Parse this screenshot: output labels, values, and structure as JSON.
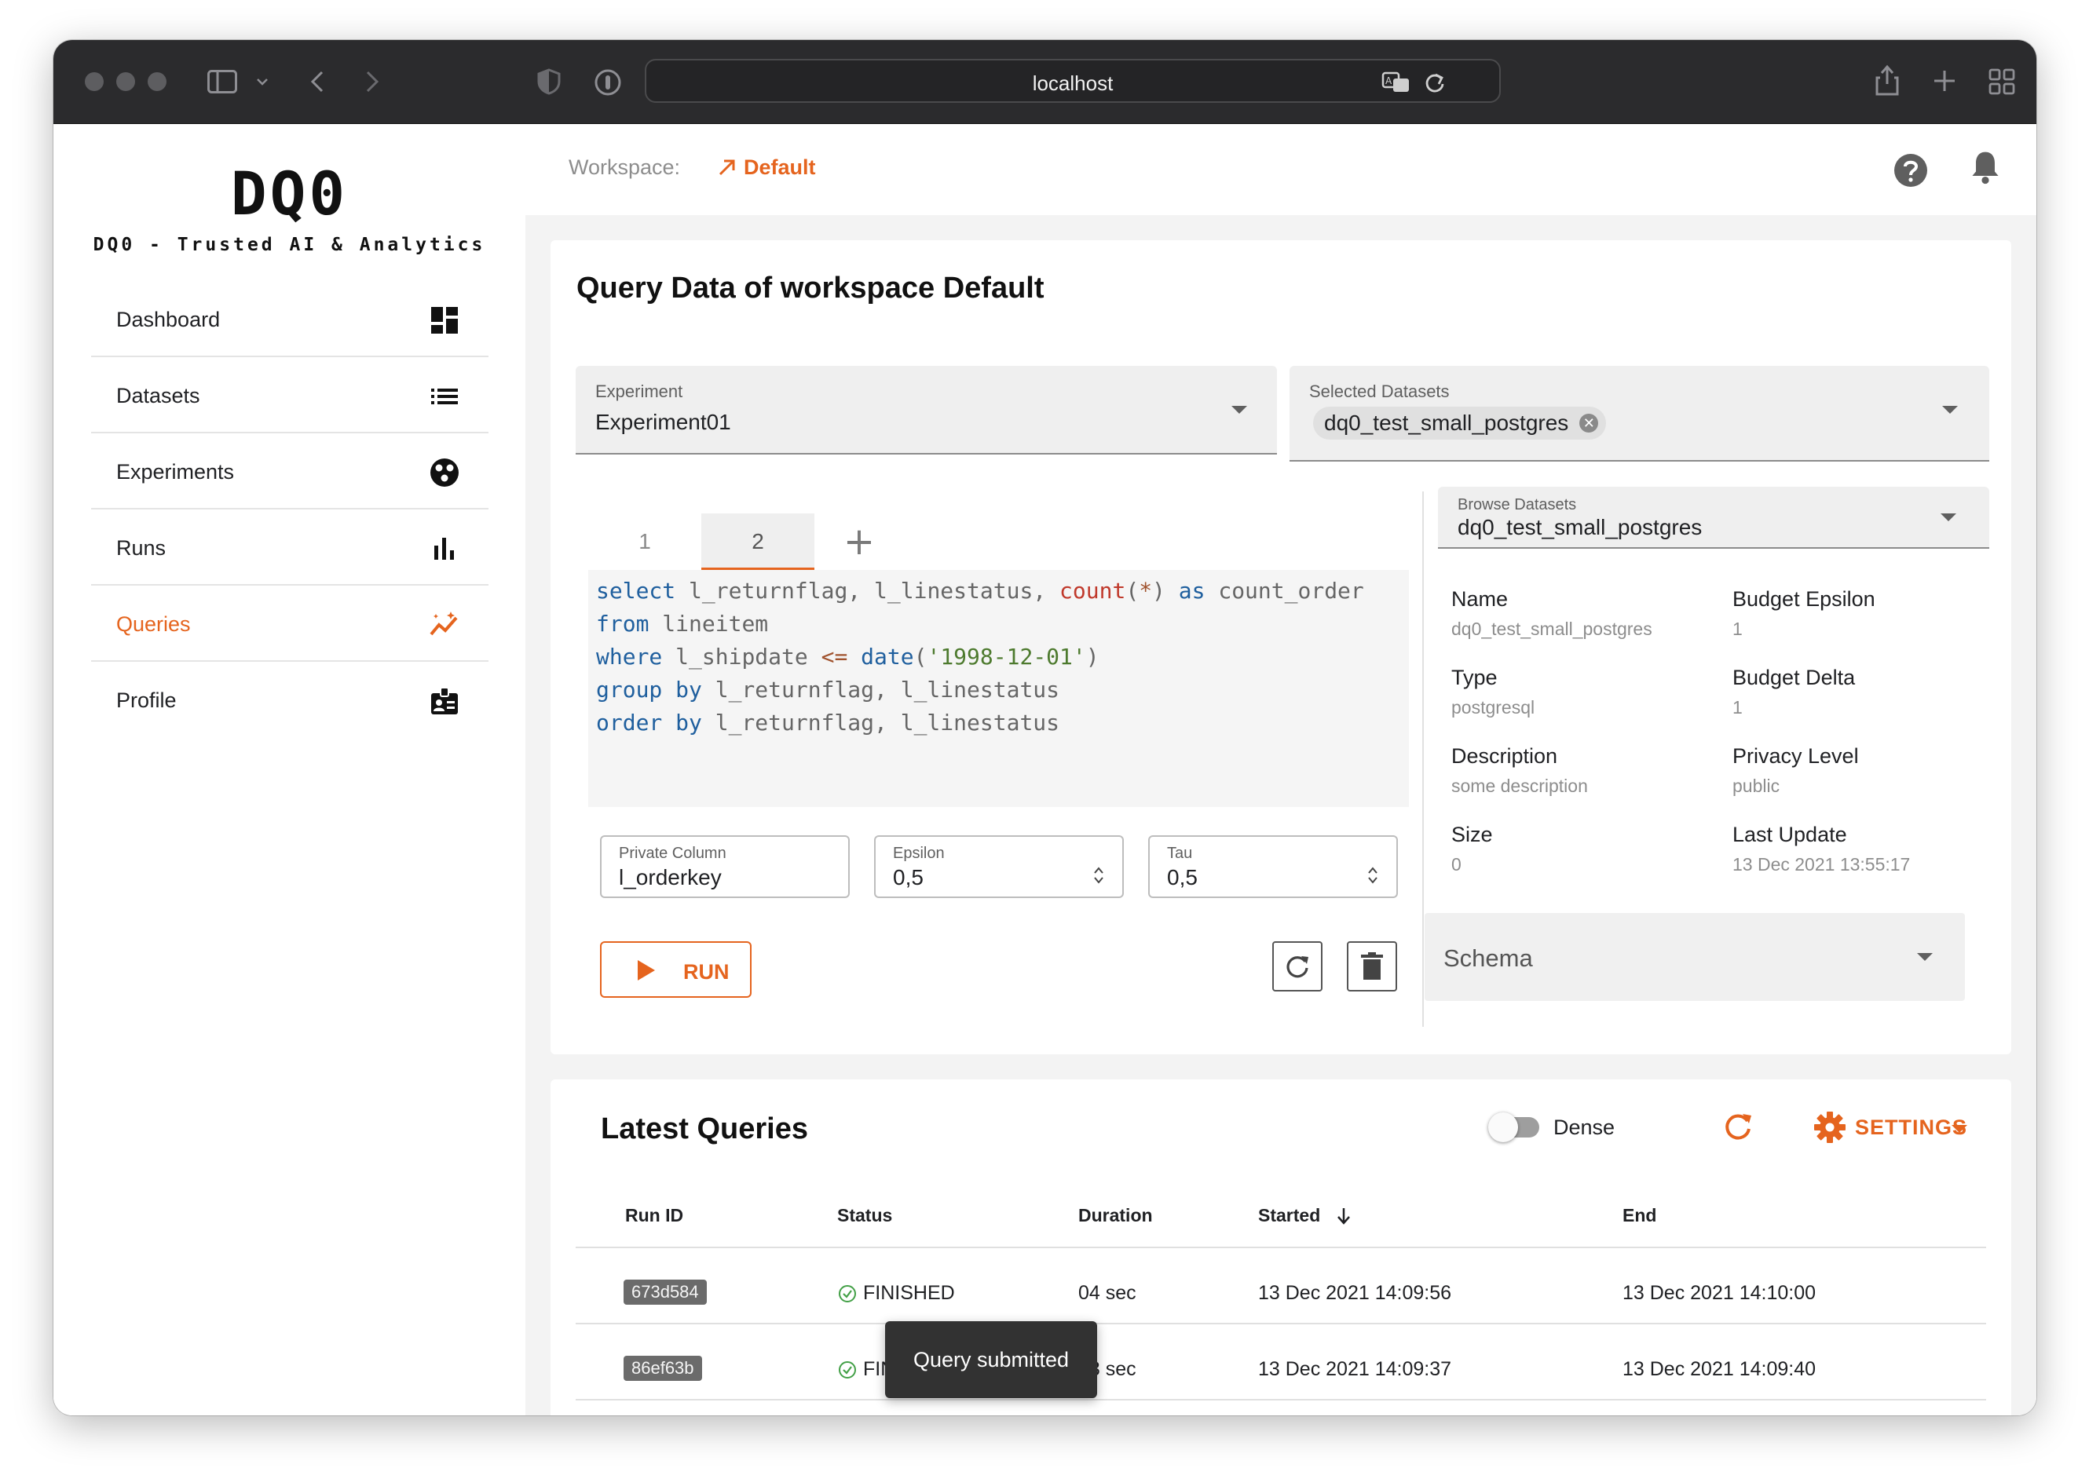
{
  "browser": {
    "url": "localhost"
  },
  "brand": {
    "logo": "DQ0",
    "tagline": "DQ0 - Trusted AI & Analytics",
    "accent_color": "#e5641e"
  },
  "sidebar": {
    "items": [
      {
        "label": "Dashboard",
        "icon": "dashboard-icon",
        "active": false
      },
      {
        "label": "Datasets",
        "icon": "list-icon",
        "active": false
      },
      {
        "label": "Experiments",
        "icon": "experiments-icon",
        "active": false
      },
      {
        "label": "Runs",
        "icon": "bar-chart-icon",
        "active": false
      },
      {
        "label": "Queries",
        "icon": "queries-icon",
        "active": true
      },
      {
        "label": "Profile",
        "icon": "profile-badge-icon",
        "active": false
      }
    ]
  },
  "topbar": {
    "workspace_label": "Workspace:",
    "workspace_value": "Default"
  },
  "query_card": {
    "title": "Query Data of workspace Default",
    "experiment": {
      "label": "Experiment",
      "value": "Experiment01"
    },
    "selected_datasets": {
      "label": "Selected Datasets",
      "chip": "dq0_test_small_postgres"
    },
    "tabs": [
      {
        "label": "1",
        "active": false
      },
      {
        "label": "2",
        "active": true
      }
    ],
    "code_lines": [
      "select l_returnflag, l_linestatus, count(*) as count_order",
      "from lineitem",
      "where l_shipdate <= date('1998-12-01')",
      "group by l_returnflag, l_linestatus",
      "order by l_returnflag, l_linestatus"
    ],
    "fields": {
      "private_column": {
        "label": "Private Column",
        "value": "l_orderkey"
      },
      "epsilon": {
        "label": "Epsilon",
        "value": "0,5"
      },
      "tau": {
        "label": "Tau",
        "value": "0,5"
      }
    },
    "run_label": "RUN",
    "browse_datasets": {
      "label": "Browse Datasets",
      "value": "dq0_test_small_postgres"
    },
    "details": {
      "name": {
        "label": "Name",
        "value": "dq0_test_small_postgres"
      },
      "budget_epsilon": {
        "label": "Budget Epsilon",
        "value": "1"
      },
      "type": {
        "label": "Type",
        "value": "postgresql"
      },
      "budget_delta": {
        "label": "Budget Delta",
        "value": "1"
      },
      "description": {
        "label": "Description",
        "value": "some description"
      },
      "privacy_level": {
        "label": "Privacy Level",
        "value": "public"
      },
      "size": {
        "label": "Size",
        "value": "0"
      },
      "last_update": {
        "label": "Last Update",
        "value": "13 Dec 2021 13:55:17"
      }
    },
    "schema_label": "Schema"
  },
  "latest": {
    "title": "Latest Queries",
    "dense_label": "Dense",
    "dense_on": false,
    "settings_label": "SETTINGS",
    "columns": {
      "run_id": "Run ID",
      "status": "Status",
      "duration": "Duration",
      "started": "Started",
      "end": "End"
    },
    "rows": [
      {
        "run_id": "673d584",
        "status": "FINISHED",
        "duration": "04 sec",
        "started": "13 Dec 2021 14:09:56",
        "end": "13 Dec 2021 14:10:00"
      },
      {
        "run_id": "86ef63b",
        "status": "FINISHED",
        "duration": "03 sec",
        "started": "13 Dec 2021 14:09:37",
        "end": "13 Dec 2021 14:09:40"
      }
    ]
  },
  "toast": {
    "message": "Query submitted"
  }
}
